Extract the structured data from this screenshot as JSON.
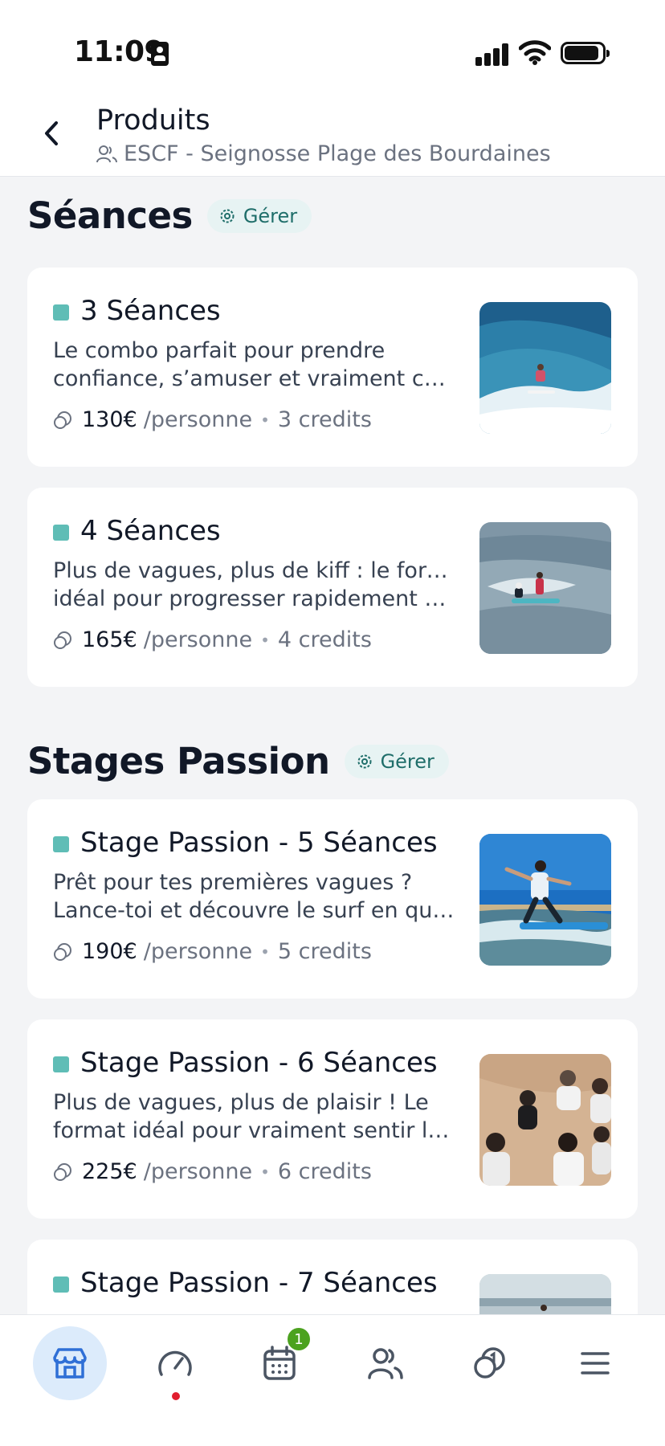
{
  "status_bar": {
    "time": "11:09"
  },
  "header": {
    "title": "Produits",
    "subtitle": "ESCF - Seignosse Plage des Bourdaines"
  },
  "sections": [
    {
      "title": "Séances",
      "manage_label": "Gérer"
    },
    {
      "title": "Stages Passion",
      "manage_label": "Gérer"
    }
  ],
  "products": [
    {
      "name": "3 Séances",
      "desc_line1": "Le combo parfait pour prendre",
      "desc_line2": "confiance, s’amuser et vraiment com…",
      "price": "130€",
      "unit": "/personne",
      "credits": "3 credits"
    },
    {
      "name": "4 Séances",
      "desc_line1": "Plus de vagues, plus de kiff : le format",
      "desc_line2": "idéal pour progresser rapidement tou…",
      "price": "165€",
      "unit": "/personne",
      "credits": "4 credits"
    },
    {
      "name": "Stage Passion - 5 Séances",
      "desc_line1": "Prêt pour tes premières vagues ?",
      "desc_line2": "Lance-toi et découvre le surf en quel…",
      "price": "190€",
      "unit": "/personne",
      "credits": "5 credits"
    },
    {
      "name": "Stage Passion - 6 Séances",
      "desc_line1": "Plus de vagues, plus de plaisir ! Le",
      "desc_line2": "format idéal pour vraiment sentir la p…",
      "price": "225€",
      "unit": "/personne",
      "credits": "6 credits"
    },
    {
      "name": "Stage Passion - 7 Séances"
    }
  ],
  "bottom_nav": {
    "calendar_badge": "1",
    "items": [
      "store-icon",
      "dashboard-icon",
      "calendar-icon",
      "users-icon",
      "coins-icon",
      "menu-icon"
    ]
  },
  "colors": {
    "accent_teal": "#5FBDB6",
    "manage_bg": "#E7F3F3",
    "nav_active_bg": "#DCEBFB",
    "nav_active_icon": "#2F6FD6",
    "badge_green": "#4CA21F",
    "alert_red": "#E11D2E"
  }
}
